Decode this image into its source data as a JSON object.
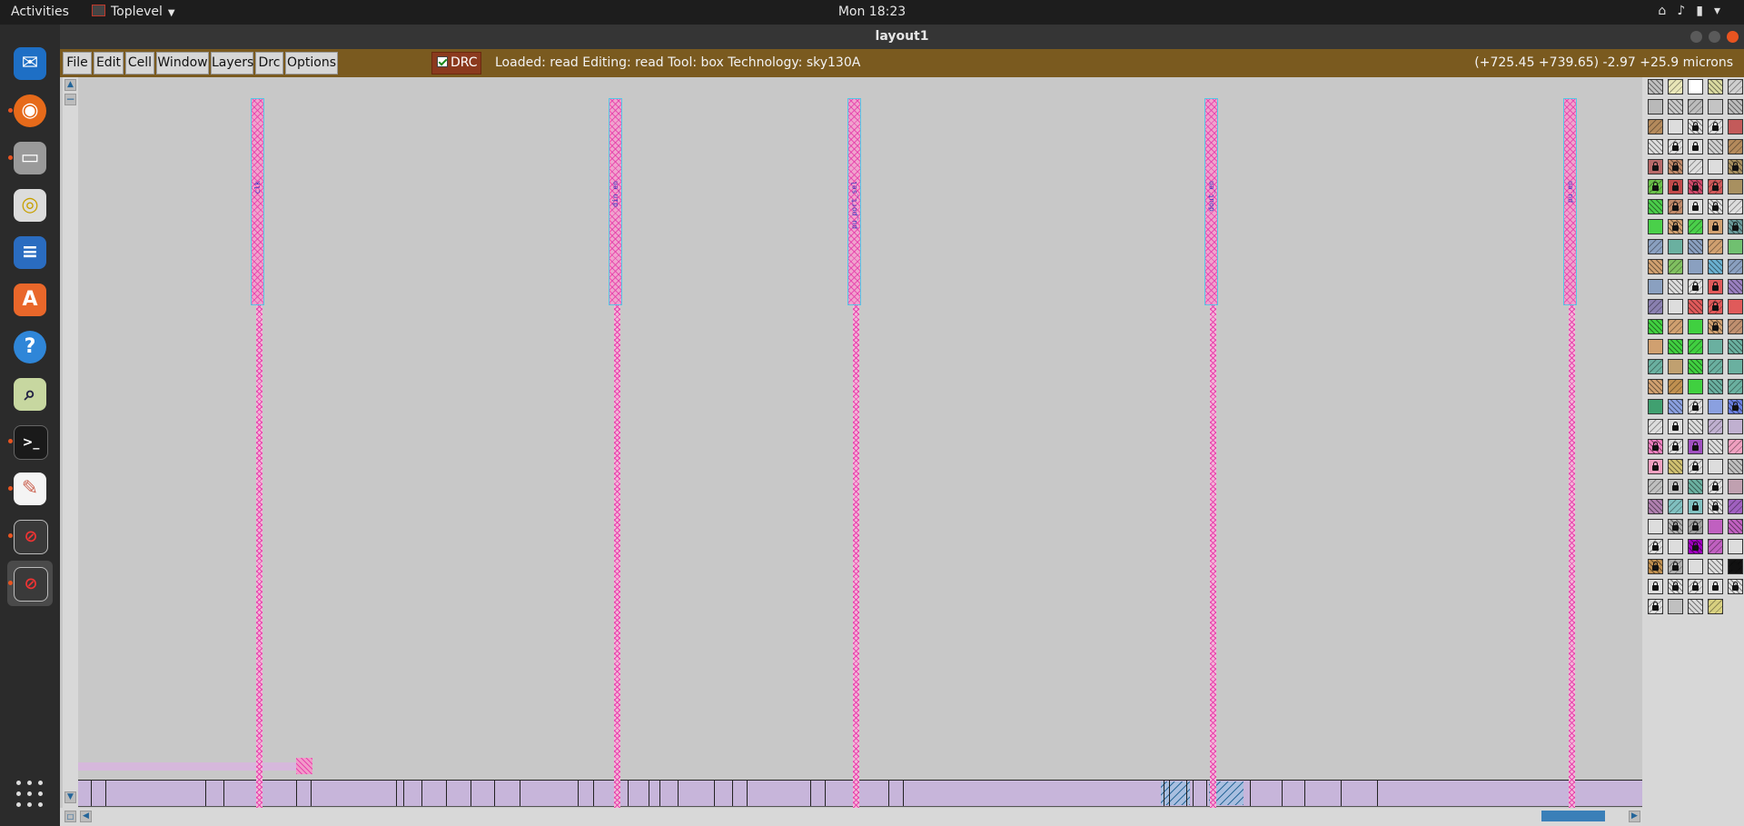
{
  "topbar": {
    "activities": "Activities",
    "app_name": "Toplevel",
    "clock": "Mon 18:23"
  },
  "window": {
    "title": "layout1"
  },
  "menu": [
    "File",
    "Edit",
    "Cell",
    "Window",
    "Layers",
    "Drc",
    "Options"
  ],
  "drc_toggle": {
    "label": "DRC",
    "checked": true
  },
  "status": "Loaded: read Editing: read Tool: box  Technology: sky130A",
  "coords": "(+725.45 +739.65) -2.97 +25.9 microns",
  "pins": [
    {
      "label": "clk"
    },
    {
      "label": "din_en"
    },
    {
      "label": "pu_port_sel"
    },
    {
      "label": "dout_en"
    },
    {
      "label": "pu_en"
    }
  ],
  "dock_icons": [
    "thunderbird-icon",
    "firefox-icon",
    "files-icon",
    "rhythmbox-icon",
    "writer-icon",
    "software-icon",
    "help-icon",
    "magic-icon",
    "terminal-icon",
    "text-editor-icon",
    "layout-window-icon",
    "layout-window-icon",
    "show-apps-icon"
  ]
}
